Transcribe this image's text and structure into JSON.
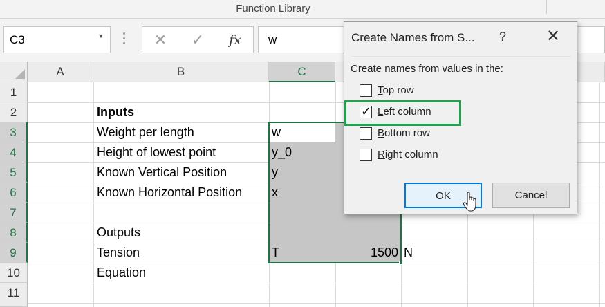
{
  "ribbon": {
    "group_label": "Function Library"
  },
  "formula_bar": {
    "name_box": "C3",
    "cancel_glyph": "✕",
    "enter_glyph": "✓",
    "fx_label": "fx",
    "formula_value": "w"
  },
  "sheet": {
    "columns": [
      "A",
      "B",
      "C"
    ],
    "rows": [
      "1",
      "2",
      "3",
      "4",
      "5",
      "6",
      "7",
      "8",
      "9",
      "10",
      "11"
    ],
    "cells": {
      "B2": "Inputs",
      "B3": "Weight per length",
      "B4": "Height of lowest point",
      "B5": "Known Vertical Position",
      "B6": "Known Horizontal Position",
      "B8": "Outputs",
      "B9": "Tension",
      "B10": "Equation",
      "C3": "w",
      "C4": "y_0",
      "C5": "y",
      "C6": "x",
      "C9": "T",
      "D9": "1500",
      "E9": "N"
    },
    "active_cell": "C3",
    "accent_color": "#217346"
  },
  "dialog": {
    "title": "Create Names from S...",
    "help": "?",
    "close": "✕",
    "prompt": "Create names from values in the:",
    "options": [
      {
        "key": "T",
        "rest": "op row",
        "checked": false
      },
      {
        "key": "L",
        "rest": "eft column",
        "checked": true
      },
      {
        "key": "B",
        "rest": "ottom row",
        "checked": false
      },
      {
        "key": "R",
        "rest": "ight column",
        "checked": false
      }
    ],
    "check_glyph": "✓",
    "ok_label": "OK",
    "cancel_label": "Cancel",
    "highlight_color": "#21a04d"
  }
}
